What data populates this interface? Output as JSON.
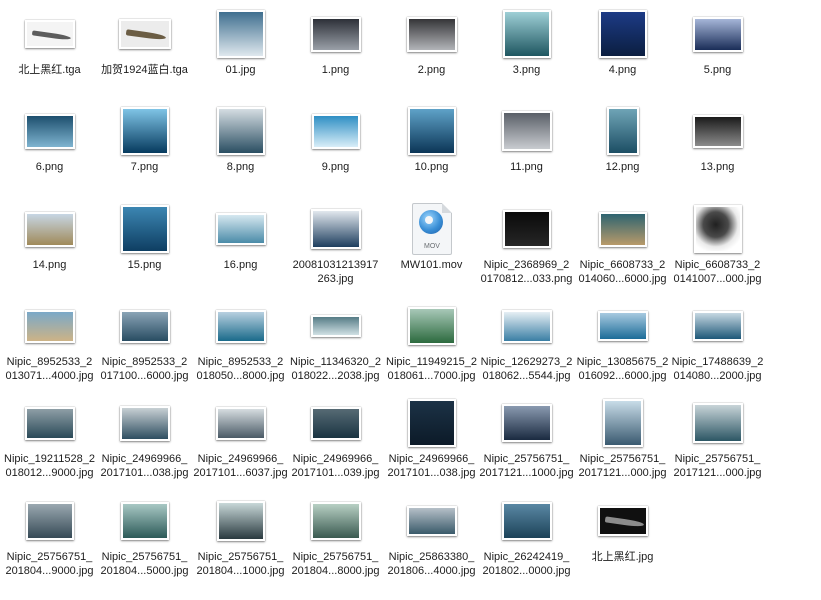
{
  "files": [
    {
      "l1": "北上黑红.tga",
      "l2": "",
      "kind": "ship",
      "w": 50,
      "h": 28,
      "bg": "#f4f4f4",
      "fg": "#5c5c5c"
    },
    {
      "l1": "加贺1924蓝白.tga",
      "l2": "",
      "kind": "ship",
      "w": 52,
      "h": 30,
      "bg": "#ececec",
      "fg": "#6b5d44"
    },
    {
      "l1": "01.jpg",
      "l2": "",
      "kind": "img",
      "w": 48,
      "h": 48,
      "c1": "#3f6f8f",
      "c2": "#dfe8ee"
    },
    {
      "l1": "1.png",
      "l2": "",
      "kind": "img",
      "w": 50,
      "h": 35,
      "c1": "#2d3038",
      "c2": "#9aa0a8"
    },
    {
      "l1": "2.png",
      "l2": "",
      "kind": "img",
      "w": 50,
      "h": 35,
      "c1": "#353538",
      "c2": "#b2b4b8"
    },
    {
      "l1": "3.png",
      "l2": "",
      "kind": "img",
      "w": 48,
      "h": 48,
      "c1": "#9ecfd6",
      "c2": "#1e5660"
    },
    {
      "l1": "4.png",
      "l2": "",
      "kind": "img",
      "w": 48,
      "h": 48,
      "c1": "#1d3b86",
      "c2": "#0b1e40"
    },
    {
      "l1": "5.png",
      "l2": "",
      "kind": "img",
      "w": 50,
      "h": 35,
      "c1": "#a6b6d8",
      "c2": "#1a2d58"
    },
    {
      "l1": "6.png",
      "l2": "",
      "kind": "img",
      "w": 50,
      "h": 35,
      "c1": "#1d4f6e",
      "c2": "#7fb4d0"
    },
    {
      "l1": "7.png",
      "l2": "",
      "kind": "img",
      "w": 48,
      "h": 48,
      "c1": "#7fc4e6",
      "c2": "#063a5e"
    },
    {
      "l1": "8.png",
      "l2": "",
      "kind": "img",
      "w": 48,
      "h": 48,
      "c1": "#d5dde2",
      "c2": "#2a4e62"
    },
    {
      "l1": "9.png",
      "l2": "",
      "kind": "img",
      "w": 48,
      "h": 35,
      "c1": "#2f8fc4",
      "c2": "#d8eef8"
    },
    {
      "l1": "10.png",
      "l2": "",
      "kind": "img",
      "w": 48,
      "h": 48,
      "c1": "#5fa2c8",
      "c2": "#0b3556"
    },
    {
      "l1": "11.png",
      "l2": "",
      "kind": "img",
      "w": 50,
      "h": 40,
      "c1": "#5a6068",
      "c2": "#c9ccd0"
    },
    {
      "l1": "12.png",
      "l2": "",
      "kind": "img",
      "w": 32,
      "h": 48,
      "c1": "#6fa4b6",
      "c2": "#1c4e64"
    },
    {
      "l1": "13.png",
      "l2": "",
      "kind": "img",
      "w": 50,
      "h": 33,
      "c1": "#1a1a1a",
      "c2": "#8c8c8c"
    },
    {
      "l1": "14.png",
      "l2": "",
      "kind": "img",
      "w": 50,
      "h": 35,
      "c1": "#c7d6e4",
      "c2": "#a08a5a"
    },
    {
      "l1": "15.png",
      "l2": "",
      "kind": "img",
      "w": 48,
      "h": 48,
      "c1": "#3c86b2",
      "c2": "#0e3e62"
    },
    {
      "l1": "16.png",
      "l2": "",
      "kind": "img",
      "w": 50,
      "h": 32,
      "c1": "#d6e8f0",
      "c2": "#4b8ba8"
    },
    {
      "l1": "20081031213917",
      "l2": "263.jpg",
      "kind": "img",
      "w": 50,
      "h": 40,
      "c1": "#e2e8ee",
      "c2": "#1e3e5e"
    },
    {
      "l1": "MW101.mov",
      "l2": "",
      "kind": "mov",
      "w": 40,
      "h": 52
    },
    {
      "l1": "Nipic_2368969_2",
      "l2": "0170812...033.png",
      "kind": "img",
      "w": 48,
      "h": 38,
      "c1": "#0a0a0a",
      "c2": "#262626"
    },
    {
      "l1": "Nipic_6608733_2",
      "l2": "014060...6000.jpg",
      "kind": "img",
      "w": 48,
      "h": 35,
      "c1": "#2e6470",
      "c2": "#b89a6a"
    },
    {
      "l1": "Nipic_6608733_2",
      "l2": "0141007...000.jpg",
      "kind": "smoke",
      "w": 48,
      "h": 48
    },
    {
      "l1": "Nipic_8952533_2",
      "l2": "013071...4000.jpg",
      "kind": "img",
      "w": 50,
      "h": 33,
      "c1": "#7aa8c8",
      "c2": "#cdb386"
    },
    {
      "l1": "Nipic_8952533_2",
      "l2": "017100...6000.jpg",
      "kind": "img",
      "w": 50,
      "h": 33,
      "c1": "#8aa4b6",
      "c2": "#284c62"
    },
    {
      "l1": "Nipic_8952533_2",
      "l2": "018050...8000.jpg",
      "kind": "img",
      "w": 50,
      "h": 33,
      "c1": "#b8d0e0",
      "c2": "#1a6a8a"
    },
    {
      "l1": "Nipic_11346320_2",
      "l2": "018022...2038.jpg",
      "kind": "img",
      "w": 50,
      "h": 22,
      "c1": "#567c86",
      "c2": "#d0e0e4"
    },
    {
      "l1": "Nipic_11949215_2",
      "l2": "018061...7000.jpg",
      "kind": "img",
      "w": 48,
      "h": 38,
      "c1": "#a8c8b8",
      "c2": "#2c6a3e"
    },
    {
      "l1": "Nipic_12629273_2",
      "l2": "018062...5544.jpg",
      "kind": "img",
      "w": 50,
      "h": 33,
      "c1": "#e6eff4",
      "c2": "#3a7ea4"
    },
    {
      "l1": "Nipic_13085675_2",
      "l2": "016092...6000.jpg",
      "kind": "img",
      "w": 50,
      "h": 30,
      "c1": "#a8cae0",
      "c2": "#1c6c98"
    },
    {
      "l1": "Nipic_17488639_2",
      "l2": "014080...2000.jpg",
      "kind": "img",
      "w": 50,
      "h": 30,
      "c1": "#c6d8e2",
      "c2": "#1e5878"
    },
    {
      "l1": "Nipic_19211528_2",
      "l2": "018012...9000.jpg",
      "kind": "img",
      "w": 50,
      "h": 33,
      "c1": "#8e9ea6",
      "c2": "#2a4a58"
    },
    {
      "l1": "Nipic_24969966_",
      "l2": "2017101...038.jpg",
      "kind": "img",
      "w": 50,
      "h": 35,
      "c1": "#c8d0d4",
      "c2": "#2e4e60"
    },
    {
      "l1": "Nipic_24969966_",
      "l2": "2017101...6037.jpg",
      "kind": "img",
      "w": 50,
      "h": 33,
      "c1": "#d6dde0",
      "c2": "#4a5a66"
    },
    {
      "l1": "Nipic_24969966_",
      "l2": "2017101...039.jpg",
      "kind": "img",
      "w": 50,
      "h": 33,
      "c1": "#566a74",
      "c2": "#1a3442"
    },
    {
      "l1": "Nipic_24969966_",
      "l2": "2017101...038.jpg",
      "kind": "img",
      "w": 48,
      "h": 48,
      "c1": "#1c3246",
      "c2": "#0c1a28"
    },
    {
      "l1": "Nipic_25756751_",
      "l2": "2017121...1000.jpg",
      "kind": "img",
      "w": 50,
      "h": 38,
      "c1": "#8a9ab0",
      "c2": "#1a2a40"
    },
    {
      "l1": "Nipic_25756751_",
      "l2": "2017121...000.jpg",
      "kind": "img",
      "w": 40,
      "h": 48,
      "c1": "#c8dce8",
      "c2": "#3a5a70"
    },
    {
      "l1": "Nipic_25756751_",
      "l2": "2017121...000.jpg",
      "kind": "img",
      "w": 50,
      "h": 40,
      "c1": "#c8d4d8",
      "c2": "#2c5664"
    },
    {
      "l1": "Nipic_25756751_",
      "l2": "201804...9000.jpg",
      "kind": "img",
      "w": 48,
      "h": 38,
      "c1": "#9aa8b0",
      "c2": "#364a56"
    },
    {
      "l1": "Nipic_25756751_",
      "l2": "201804...5000.jpg",
      "kind": "img",
      "w": 48,
      "h": 38,
      "c1": "#a8c8c4",
      "c2": "#2c5a58"
    },
    {
      "l1": "Nipic_25756751_",
      "l2": "201804...1000.jpg",
      "kind": "img",
      "w": 48,
      "h": 40,
      "c1": "#c8d8d8",
      "c2": "#2a3a40"
    },
    {
      "l1": "Nipic_25756751_",
      "l2": "201804...8000.jpg",
      "kind": "img",
      "w": 50,
      "h": 38,
      "c1": "#b8d0c4",
      "c2": "#3a5a50"
    },
    {
      "l1": "Nipic_25863380_",
      "l2": "201806...4000.jpg",
      "kind": "img",
      "w": 50,
      "h": 30,
      "c1": "#b6c0c8",
      "c2": "#3a5a6a"
    },
    {
      "l1": "Nipic_26242419_",
      "l2": "201802...0000.jpg",
      "kind": "img",
      "w": 50,
      "h": 38,
      "c1": "#5a88a4",
      "c2": "#1c4258"
    },
    {
      "l1": "北上黑红.jpg",
      "l2": "",
      "kind": "ship",
      "w": 50,
      "h": 30,
      "bg": "#101010",
      "fg": "#8c8c8c"
    }
  ]
}
